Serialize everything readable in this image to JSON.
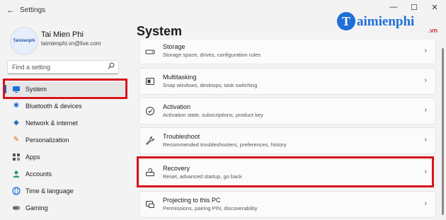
{
  "window": {
    "title": "Settings",
    "back_glyph": "←",
    "minimize": "—",
    "maximize": "☐",
    "close": "✕"
  },
  "profile": {
    "name": "Tai Mien Phi",
    "email": "taimienphi.vn@live.com",
    "avatar_text": "Taimienphi"
  },
  "search": {
    "placeholder": "Find a setting"
  },
  "nav": {
    "items": [
      {
        "label": "System",
        "icon": "monitor-icon",
        "selected": true
      },
      {
        "label": "Bluetooth & devices",
        "icon": "bluetooth-icon"
      },
      {
        "label": "Network & internet",
        "icon": "wifi-icon"
      },
      {
        "label": "Personalization",
        "icon": "brush-icon"
      },
      {
        "label": "Apps",
        "icon": "apps-icon"
      },
      {
        "label": "Accounts",
        "icon": "person-icon"
      },
      {
        "label": "Time & language",
        "icon": "globe-icon"
      },
      {
        "label": "Gaming",
        "icon": "gamepad-icon"
      }
    ]
  },
  "main": {
    "title": "System",
    "cards": [
      {
        "title": "Storage",
        "subtitle": "Storage space, drives, configuration rules",
        "icon": "storage-icon"
      },
      {
        "title": "Multitasking",
        "subtitle": "Snap windows, desktops, task switching",
        "icon": "multitasking-icon"
      },
      {
        "title": "Activation",
        "subtitle": "Activation state, subscriptions, product key",
        "icon": "activation-icon"
      },
      {
        "title": "Troubleshoot",
        "subtitle": "Recommended troubleshooters, preferences, history",
        "icon": "wrench-icon"
      },
      {
        "title": "Recovery",
        "subtitle": "Reset, advanced startup, go back",
        "icon": "recovery-icon"
      },
      {
        "title": "Projecting to this PC",
        "subtitle": "Permissions, pairing PIN, discoverability",
        "icon": "projecting-icon"
      }
    ]
  },
  "watermark": {
    "letter": "T",
    "text": "aimienphi",
    "suffix": ".vn"
  },
  "colors": {
    "accent": "#0067c0",
    "highlight_box": "#d7141c",
    "watermark": "#1e6fd9"
  }
}
